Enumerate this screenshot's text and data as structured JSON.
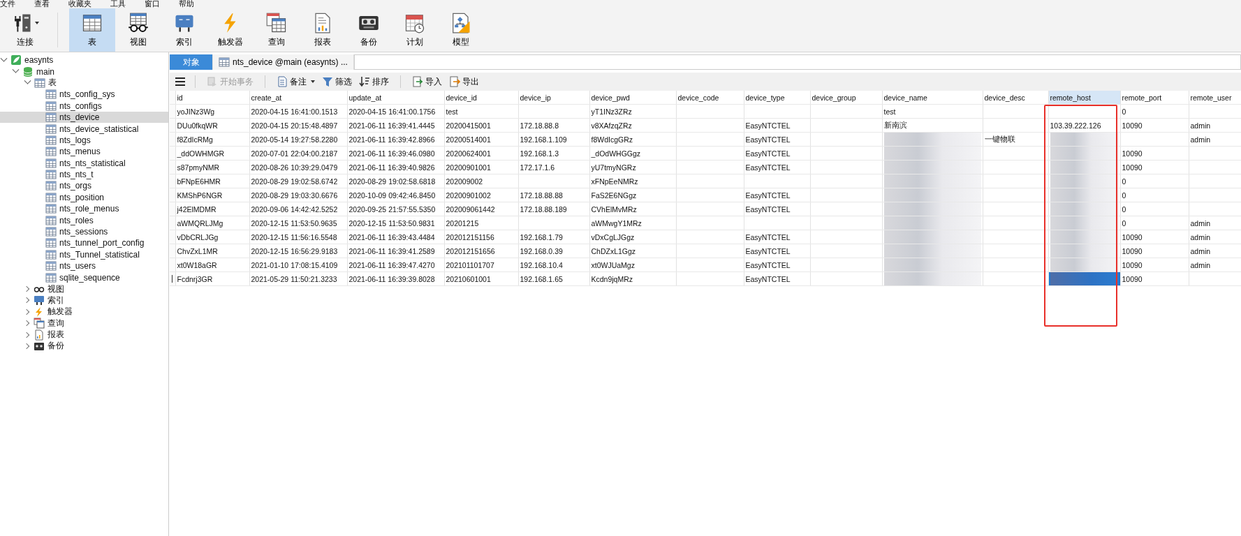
{
  "menu_bar": [
    "文件",
    "查看",
    "收藏夹",
    "工具",
    "窗口",
    "帮助"
  ],
  "toolbar": [
    {
      "label": "连接",
      "kind": "connect",
      "selected": false,
      "dropdown": true
    },
    {
      "label": "表",
      "kind": "table",
      "selected": true,
      "dropdown": false
    },
    {
      "label": "视图",
      "kind": "view",
      "selected": false,
      "dropdown": false
    },
    {
      "label": "索引",
      "kind": "index",
      "selected": false,
      "dropdown": false
    },
    {
      "label": "触发器",
      "kind": "trigger",
      "selected": false,
      "dropdown": false
    },
    {
      "label": "查询",
      "kind": "query",
      "selected": false,
      "dropdown": false
    },
    {
      "label": "报表",
      "kind": "report",
      "selected": false,
      "dropdown": false
    },
    {
      "label": "备份",
      "kind": "backup",
      "selected": false,
      "dropdown": false
    },
    {
      "label": "计划",
      "kind": "schedule",
      "selected": false,
      "dropdown": false
    },
    {
      "label": "模型",
      "kind": "model",
      "selected": false,
      "dropdown": false
    }
  ],
  "tree": [
    {
      "label": "easynts",
      "kind": "connection",
      "expanded": true,
      "selected": false,
      "children": [
        {
          "label": "main",
          "kind": "database",
          "expanded": true,
          "selected": false,
          "children": [
            {
              "label": "表",
              "kind": "table",
              "expanded": true,
              "selected": false,
              "children": [
                {
                  "label": "nts_config_sys",
                  "kind": "table",
                  "selected": false
                },
                {
                  "label": "nts_configs",
                  "kind": "table",
                  "selected": false
                },
                {
                  "label": "nts_device",
                  "kind": "table",
                  "selected": true
                },
                {
                  "label": "nts_device_statistical",
                  "kind": "table",
                  "selected": false
                },
                {
                  "label": "nts_logs",
                  "kind": "table",
                  "selected": false
                },
                {
                  "label": "nts_menus",
                  "kind": "table",
                  "selected": false
                },
                {
                  "label": "nts_nts_statistical",
                  "kind": "table",
                  "selected": false
                },
                {
                  "label": "nts_nts_t",
                  "kind": "table",
                  "selected": false
                },
                {
                  "label": "nts_orgs",
                  "kind": "table",
                  "selected": false
                },
                {
                  "label": "nts_position",
                  "kind": "table",
                  "selected": false
                },
                {
                  "label": "nts_role_menus",
                  "kind": "table",
                  "selected": false
                },
                {
                  "label": "nts_roles",
                  "kind": "table",
                  "selected": false
                },
                {
                  "label": "nts_sessions",
                  "kind": "table",
                  "selected": false
                },
                {
                  "label": "nts_tunnel_port_config",
                  "kind": "table",
                  "selected": false
                },
                {
                  "label": "nts_Tunnel_statistical",
                  "kind": "table",
                  "selected": false
                },
                {
                  "label": "nts_users",
                  "kind": "table",
                  "selected": false
                },
                {
                  "label": "sqlite_sequence",
                  "kind": "table",
                  "selected": false
                }
              ]
            },
            {
              "label": "视图",
              "kind": "view",
              "expanded": false,
              "selected": false
            },
            {
              "label": "索引",
              "kind": "index",
              "expanded": false,
              "selected": false
            },
            {
              "label": "触发器",
              "kind": "trigger",
              "expanded": false,
              "selected": false
            },
            {
              "label": "查询",
              "kind": "query",
              "expanded": false,
              "selected": false
            },
            {
              "label": "报表",
              "kind": "report",
              "expanded": false,
              "selected": false
            },
            {
              "label": "备份",
              "kind": "backup",
              "expanded": false,
              "selected": false
            }
          ]
        }
      ]
    }
  ],
  "tabs": [
    {
      "label": "对象",
      "kind": "plain",
      "selected": true
    },
    {
      "label": "nts_device @main (easynts) ...",
      "kind": "table",
      "selected": false
    }
  ],
  "actions": [
    {
      "label": "开始事务",
      "kind": "transaction",
      "disabled": true,
      "dropdown": false
    },
    {
      "label": "备注",
      "kind": "note",
      "disabled": false,
      "dropdown": true
    },
    {
      "label": "筛选",
      "kind": "filter",
      "disabled": false,
      "dropdown": false
    },
    {
      "label": "排序",
      "kind": "sort",
      "disabled": false,
      "dropdown": false
    },
    {
      "label": "导入",
      "kind": "import",
      "disabled": false,
      "dropdown": false
    },
    {
      "label": "导出",
      "kind": "export",
      "disabled": false,
      "dropdown": false
    }
  ],
  "table": {
    "columns": [
      {
        "label": "id",
        "selected": false,
        "annotated": false
      },
      {
        "label": "create_at",
        "selected": false,
        "annotated": false
      },
      {
        "label": "update_at",
        "selected": false,
        "annotated": false
      },
      {
        "label": "device_id",
        "selected": false,
        "annotated": false
      },
      {
        "label": "device_ip",
        "selected": false,
        "annotated": false
      },
      {
        "label": "device_pwd",
        "selected": false,
        "annotated": false
      },
      {
        "label": "device_code",
        "selected": false,
        "annotated": false
      },
      {
        "label": "device_type",
        "selected": false,
        "annotated": false
      },
      {
        "label": "device_group",
        "selected": false,
        "annotated": false
      },
      {
        "label": "device_name",
        "selected": false,
        "annotated": false
      },
      {
        "label": "device_desc",
        "selected": false,
        "annotated": false
      },
      {
        "label": "remote_host",
        "selected": true,
        "annotated": true
      },
      {
        "label": "remote_port",
        "selected": false,
        "annotated": false
      },
      {
        "label": "remote_user",
        "selected": false,
        "annotated": false
      }
    ],
    "rows": [
      {
        "selected": false,
        "cells": [
          {
            "kind": "text",
            "text": "yoJINz3Wg"
          },
          {
            "kind": "text",
            "text": "2020-04-15 16:41:00.1513"
          },
          {
            "kind": "text",
            "text": "2020-04-15 16:41:00.1756"
          },
          {
            "kind": "text",
            "text": "test"
          },
          {
            "kind": "empty"
          },
          {
            "kind": "text",
            "text": "yT1INz3ZRz"
          },
          {
            "kind": "empty"
          },
          {
            "kind": "empty"
          },
          {
            "kind": "empty"
          },
          {
            "kind": "text",
            "text": "test"
          },
          {
            "kind": "empty"
          },
          {
            "kind": "empty"
          },
          {
            "kind": "text",
            "text": "0"
          },
          {
            "kind": "empty"
          }
        ]
      },
      {
        "selected": false,
        "cells": [
          {
            "kind": "text",
            "text": "DUu0fkqWR"
          },
          {
            "kind": "text",
            "text": "2020-04-15 20:15:48.4897"
          },
          {
            "kind": "text",
            "text": "2021-06-11 16:39:41.4445"
          },
          {
            "kind": "text",
            "text": "20200415001"
          },
          {
            "kind": "text",
            "text": "172.18.88.8"
          },
          {
            "kind": "text",
            "text": "v8XAfzqZRz"
          },
          {
            "kind": "empty"
          },
          {
            "kind": "text",
            "text": "EasyNTCTEL"
          },
          {
            "kind": "empty"
          },
          {
            "kind": "text",
            "text": "新南滨"
          },
          {
            "kind": "empty"
          },
          {
            "kind": "text",
            "text": "103.39.222.126"
          },
          {
            "kind": "text",
            "text": "10090"
          },
          {
            "kind": "text",
            "text": "admin"
          }
        ]
      },
      {
        "selected": false,
        "cells": [
          {
            "kind": "text",
            "text": "f8ZdIcRMg"
          },
          {
            "kind": "text",
            "text": "2020-05-14 19:27:58.2280"
          },
          {
            "kind": "text",
            "text": "2021-06-11 16:39:42.8966"
          },
          {
            "kind": "text",
            "text": "20200514001"
          },
          {
            "kind": "text",
            "text": "192.168.1.109"
          },
          {
            "kind": "text",
            "text": "f8WdIcgGRz"
          },
          {
            "kind": "empty"
          },
          {
            "kind": "text",
            "text": "EasyNTCTEL"
          },
          {
            "kind": "empty"
          },
          {
            "kind": "blurred"
          },
          {
            "kind": "text",
            "text": "一键物联"
          },
          {
            "kind": "blurred"
          },
          {
            "kind": "empty"
          },
          {
            "kind": "text",
            "text": "admin"
          }
        ]
      },
      {
        "selected": false,
        "cells": [
          {
            "kind": "text",
            "text": "_ddOWHMGR"
          },
          {
            "kind": "text",
            "text": "2020-07-01 22:04:00.2187"
          },
          {
            "kind": "text",
            "text": "2021-06-11 16:39:46.0980"
          },
          {
            "kind": "text",
            "text": "20200624001"
          },
          {
            "kind": "text",
            "text": "192.168.1.3"
          },
          {
            "kind": "text",
            "text": "_dOdWHGGgz"
          },
          {
            "kind": "empty"
          },
          {
            "kind": "text",
            "text": "EasyNTCTEL"
          },
          {
            "kind": "empty"
          },
          {
            "kind": "blurred"
          },
          {
            "kind": "empty"
          },
          {
            "kind": "blurred"
          },
          {
            "kind": "text",
            "text": "10090"
          },
          {
            "kind": "empty"
          }
        ]
      },
      {
        "selected": false,
        "cells": [
          {
            "kind": "text",
            "text": "s87pmyNMR"
          },
          {
            "kind": "text",
            "text": "2020-08-26 10:39:29.0479"
          },
          {
            "kind": "text",
            "text": "2021-06-11 16:39:40.9826"
          },
          {
            "kind": "text",
            "text": "20200901001"
          },
          {
            "kind": "text",
            "text": "172.17.1.6"
          },
          {
            "kind": "text",
            "text": "yU7tmyNGRz"
          },
          {
            "kind": "empty"
          },
          {
            "kind": "text",
            "text": "EasyNTCTEL"
          },
          {
            "kind": "empty"
          },
          {
            "kind": "blurred"
          },
          {
            "kind": "empty"
          },
          {
            "kind": "blurred"
          },
          {
            "kind": "text",
            "text": "10090"
          },
          {
            "kind": "empty"
          }
        ]
      },
      {
        "selected": false,
        "cells": [
          {
            "kind": "text",
            "text": "bFNpE6HMR"
          },
          {
            "kind": "text",
            "text": "2020-08-29 19:02:58.6742"
          },
          {
            "kind": "text",
            "text": "2020-08-29 19:02:58.6818"
          },
          {
            "kind": "text",
            "text": "202009002"
          },
          {
            "kind": "empty"
          },
          {
            "kind": "text",
            "text": "xFNpEeNMRz"
          },
          {
            "kind": "empty"
          },
          {
            "kind": "empty"
          },
          {
            "kind": "empty"
          },
          {
            "kind": "blurred"
          },
          {
            "kind": "empty"
          },
          {
            "kind": "blurred"
          },
          {
            "kind": "text",
            "text": "0"
          },
          {
            "kind": "empty"
          }
        ]
      },
      {
        "selected": false,
        "cells": [
          {
            "kind": "text",
            "text": "KMShP6NGR"
          },
          {
            "kind": "text",
            "text": "2020-08-29 19:03:30.6676"
          },
          {
            "kind": "text",
            "text": "2020-10-09 09:42:46.8450"
          },
          {
            "kind": "text",
            "text": "20200901002"
          },
          {
            "kind": "text",
            "text": "172.18.88.88"
          },
          {
            "kind": "text",
            "text": "FaS2E6NGgz"
          },
          {
            "kind": "empty"
          },
          {
            "kind": "text",
            "text": "EasyNTCTEL"
          },
          {
            "kind": "empty"
          },
          {
            "kind": "blurred"
          },
          {
            "kind": "empty"
          },
          {
            "kind": "blurred"
          },
          {
            "kind": "text",
            "text": "0"
          },
          {
            "kind": "empty"
          }
        ]
      },
      {
        "selected": false,
        "cells": [
          {
            "kind": "text",
            "text": "j42ElMDMR"
          },
          {
            "kind": "text",
            "text": "2020-09-06 14:42:42.5252"
          },
          {
            "kind": "text",
            "text": "2020-09-25 21:57:55.5350"
          },
          {
            "kind": "text",
            "text": "202009061442"
          },
          {
            "kind": "text",
            "text": "172.18.88.189"
          },
          {
            "kind": "text",
            "text": "CVhElMvMRz"
          },
          {
            "kind": "empty"
          },
          {
            "kind": "text",
            "text": "EasyNTCTEL"
          },
          {
            "kind": "empty"
          },
          {
            "kind": "blurred"
          },
          {
            "kind": "empty"
          },
          {
            "kind": "blurred"
          },
          {
            "kind": "text",
            "text": "0"
          },
          {
            "kind": "empty"
          }
        ]
      },
      {
        "selected": false,
        "cells": [
          {
            "kind": "text",
            "text": "aWMQRLJMg"
          },
          {
            "kind": "text",
            "text": "2020-12-15 11:53:50.9635"
          },
          {
            "kind": "text",
            "text": "2020-12-15 11:53:50.9831"
          },
          {
            "kind": "text",
            "text": "20201215"
          },
          {
            "kind": "empty"
          },
          {
            "kind": "text",
            "text": "aWMwgY1MRz"
          },
          {
            "kind": "empty"
          },
          {
            "kind": "empty"
          },
          {
            "kind": "empty"
          },
          {
            "kind": "blurred"
          },
          {
            "kind": "empty"
          },
          {
            "kind": "blurred"
          },
          {
            "kind": "text",
            "text": "0"
          },
          {
            "kind": "text",
            "text": "admin"
          }
        ]
      },
      {
        "selected": false,
        "cells": [
          {
            "kind": "text",
            "text": "vDbCRLJGg"
          },
          {
            "kind": "text",
            "text": "2020-12-15 11:56:16.5548"
          },
          {
            "kind": "text",
            "text": "2021-06-11 16:39:43.4484"
          },
          {
            "kind": "text",
            "text": "202012151156"
          },
          {
            "kind": "text",
            "text": "192.168.1.79"
          },
          {
            "kind": "text",
            "text": "vDxCgLJGgz"
          },
          {
            "kind": "empty"
          },
          {
            "kind": "text",
            "text": "EasyNTCTEL"
          },
          {
            "kind": "empty"
          },
          {
            "kind": "blurred"
          },
          {
            "kind": "empty"
          },
          {
            "kind": "blurred"
          },
          {
            "kind": "text",
            "text": "10090"
          },
          {
            "kind": "text",
            "text": "admin"
          }
        ]
      },
      {
        "selected": false,
        "cells": [
          {
            "kind": "text",
            "text": "ChvZxL1MR"
          },
          {
            "kind": "text",
            "text": "2020-12-15 16:56:29.9183"
          },
          {
            "kind": "text",
            "text": "2021-06-11 16:39:41.2589"
          },
          {
            "kind": "text",
            "text": "202012151656"
          },
          {
            "kind": "text",
            "text": "192.168.0.39"
          },
          {
            "kind": "text",
            "text": "ChDZxL1Ggz"
          },
          {
            "kind": "empty"
          },
          {
            "kind": "text",
            "text": "EasyNTCTEL"
          },
          {
            "kind": "empty"
          },
          {
            "kind": "blurred"
          },
          {
            "kind": "empty"
          },
          {
            "kind": "blurred"
          },
          {
            "kind": "text",
            "text": "10090"
          },
          {
            "kind": "text",
            "text": "admin"
          }
        ]
      },
      {
        "selected": false,
        "cells": [
          {
            "kind": "text",
            "text": "xt0W18aGR"
          },
          {
            "kind": "text",
            "text": "2021-01-10 17:08:15.4109"
          },
          {
            "kind": "text",
            "text": "2021-06-11 16:39:47.4270"
          },
          {
            "kind": "text",
            "text": "202101101707"
          },
          {
            "kind": "text",
            "text": "192.168.10.4"
          },
          {
            "kind": "text",
            "text": "xt0WJUaMgz"
          },
          {
            "kind": "empty"
          },
          {
            "kind": "text",
            "text": "EasyNTCTEL"
          },
          {
            "kind": "empty"
          },
          {
            "kind": "blurred"
          },
          {
            "kind": "empty"
          },
          {
            "kind": "blurred"
          },
          {
            "kind": "text",
            "text": "10090"
          },
          {
            "kind": "text",
            "text": "admin"
          }
        ]
      },
      {
        "selected": true,
        "cells": [
          {
            "kind": "text",
            "text": "Fcdnrj3GR"
          },
          {
            "kind": "text",
            "text": "2021-05-29 11:50:21.3233"
          },
          {
            "kind": "text",
            "text": "2021-06-11 16:39:39.8028"
          },
          {
            "kind": "text",
            "text": "20210601001"
          },
          {
            "kind": "text",
            "text": "192.168.1.65"
          },
          {
            "kind": "text",
            "text": "Kcdn9jqMRz"
          },
          {
            "kind": "empty"
          },
          {
            "kind": "text",
            "text": "EasyNTCTEL"
          },
          {
            "kind": "empty"
          },
          {
            "kind": "blurred"
          },
          {
            "kind": "empty"
          },
          {
            "kind": "blurred"
          },
          {
            "kind": "text",
            "text": "10090"
          },
          {
            "kind": "empty"
          }
        ]
      }
    ]
  }
}
